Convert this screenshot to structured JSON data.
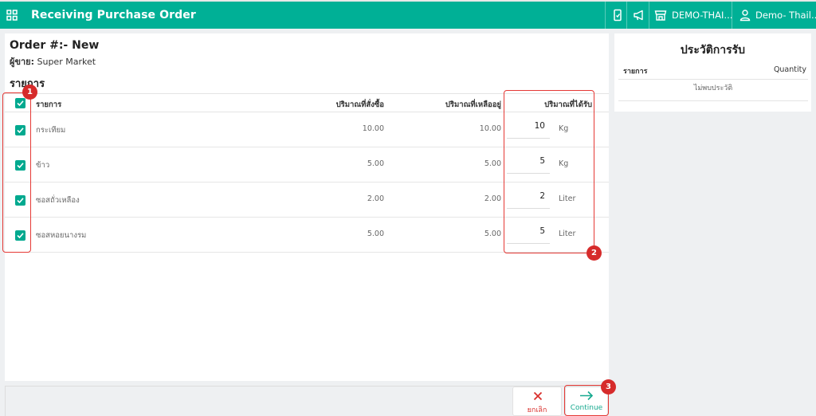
{
  "header": {
    "app_title": "Receiving Purchase Order",
    "branch_label": "DEMO-THAI...",
    "user_label": "Demo- Thail..."
  },
  "order": {
    "title": "Order #:- New",
    "vendor_label": "ผู้ขาย:",
    "vendor_name": "Super Market"
  },
  "items_section": {
    "title": "รายการ",
    "columns": {
      "item": "รายการ",
      "ordered": "ปริมาณที่สั่งซื้อ",
      "remaining": "ปริมาณที่เหลืออยู่",
      "received": "ปริมาณที่ได้รับ"
    },
    "rows": [
      {
        "name": "กระเทียม",
        "ordered": "10.00",
        "remaining": "10.00",
        "received": "10",
        "unit": "Kg",
        "checked": true
      },
      {
        "name": "ข้าว",
        "ordered": "5.00",
        "remaining": "5.00",
        "received": "5",
        "unit": "Kg",
        "checked": true
      },
      {
        "name": "ซอสถั่วเหลือง",
        "ordered": "2.00",
        "remaining": "2.00",
        "received": "2",
        "unit": "Liter",
        "checked": true
      },
      {
        "name": "ซอสหอยนางรม",
        "ordered": "5.00",
        "remaining": "5.00",
        "received": "5",
        "unit": "Liter",
        "checked": true
      }
    ]
  },
  "history": {
    "title": "ประวัติการรับ",
    "col_item": "รายการ",
    "col_qty": "Quantity",
    "empty_text": "ไม่พบประวัติ"
  },
  "actions": {
    "cancel_label": "ยกเลิก",
    "continue_label": "Continue"
  },
  "annotations": {
    "badge_1": "1",
    "badge_2": "2",
    "badge_3": "3"
  },
  "colors": {
    "brand": "#00b096",
    "checkbox": "#00a98f",
    "highlight": "#e53935",
    "cancel": "#d9302c",
    "continue": "#17a98f"
  },
  "icons": {
    "apps": "apps-grid-icon",
    "mobile": "mobile-icon",
    "megaphone": "megaphone-icon",
    "store": "store-icon",
    "user": "user-icon",
    "cancel": "close-icon",
    "continue": "arrow-right-icon",
    "checkbox": "checkmark-icon"
  }
}
